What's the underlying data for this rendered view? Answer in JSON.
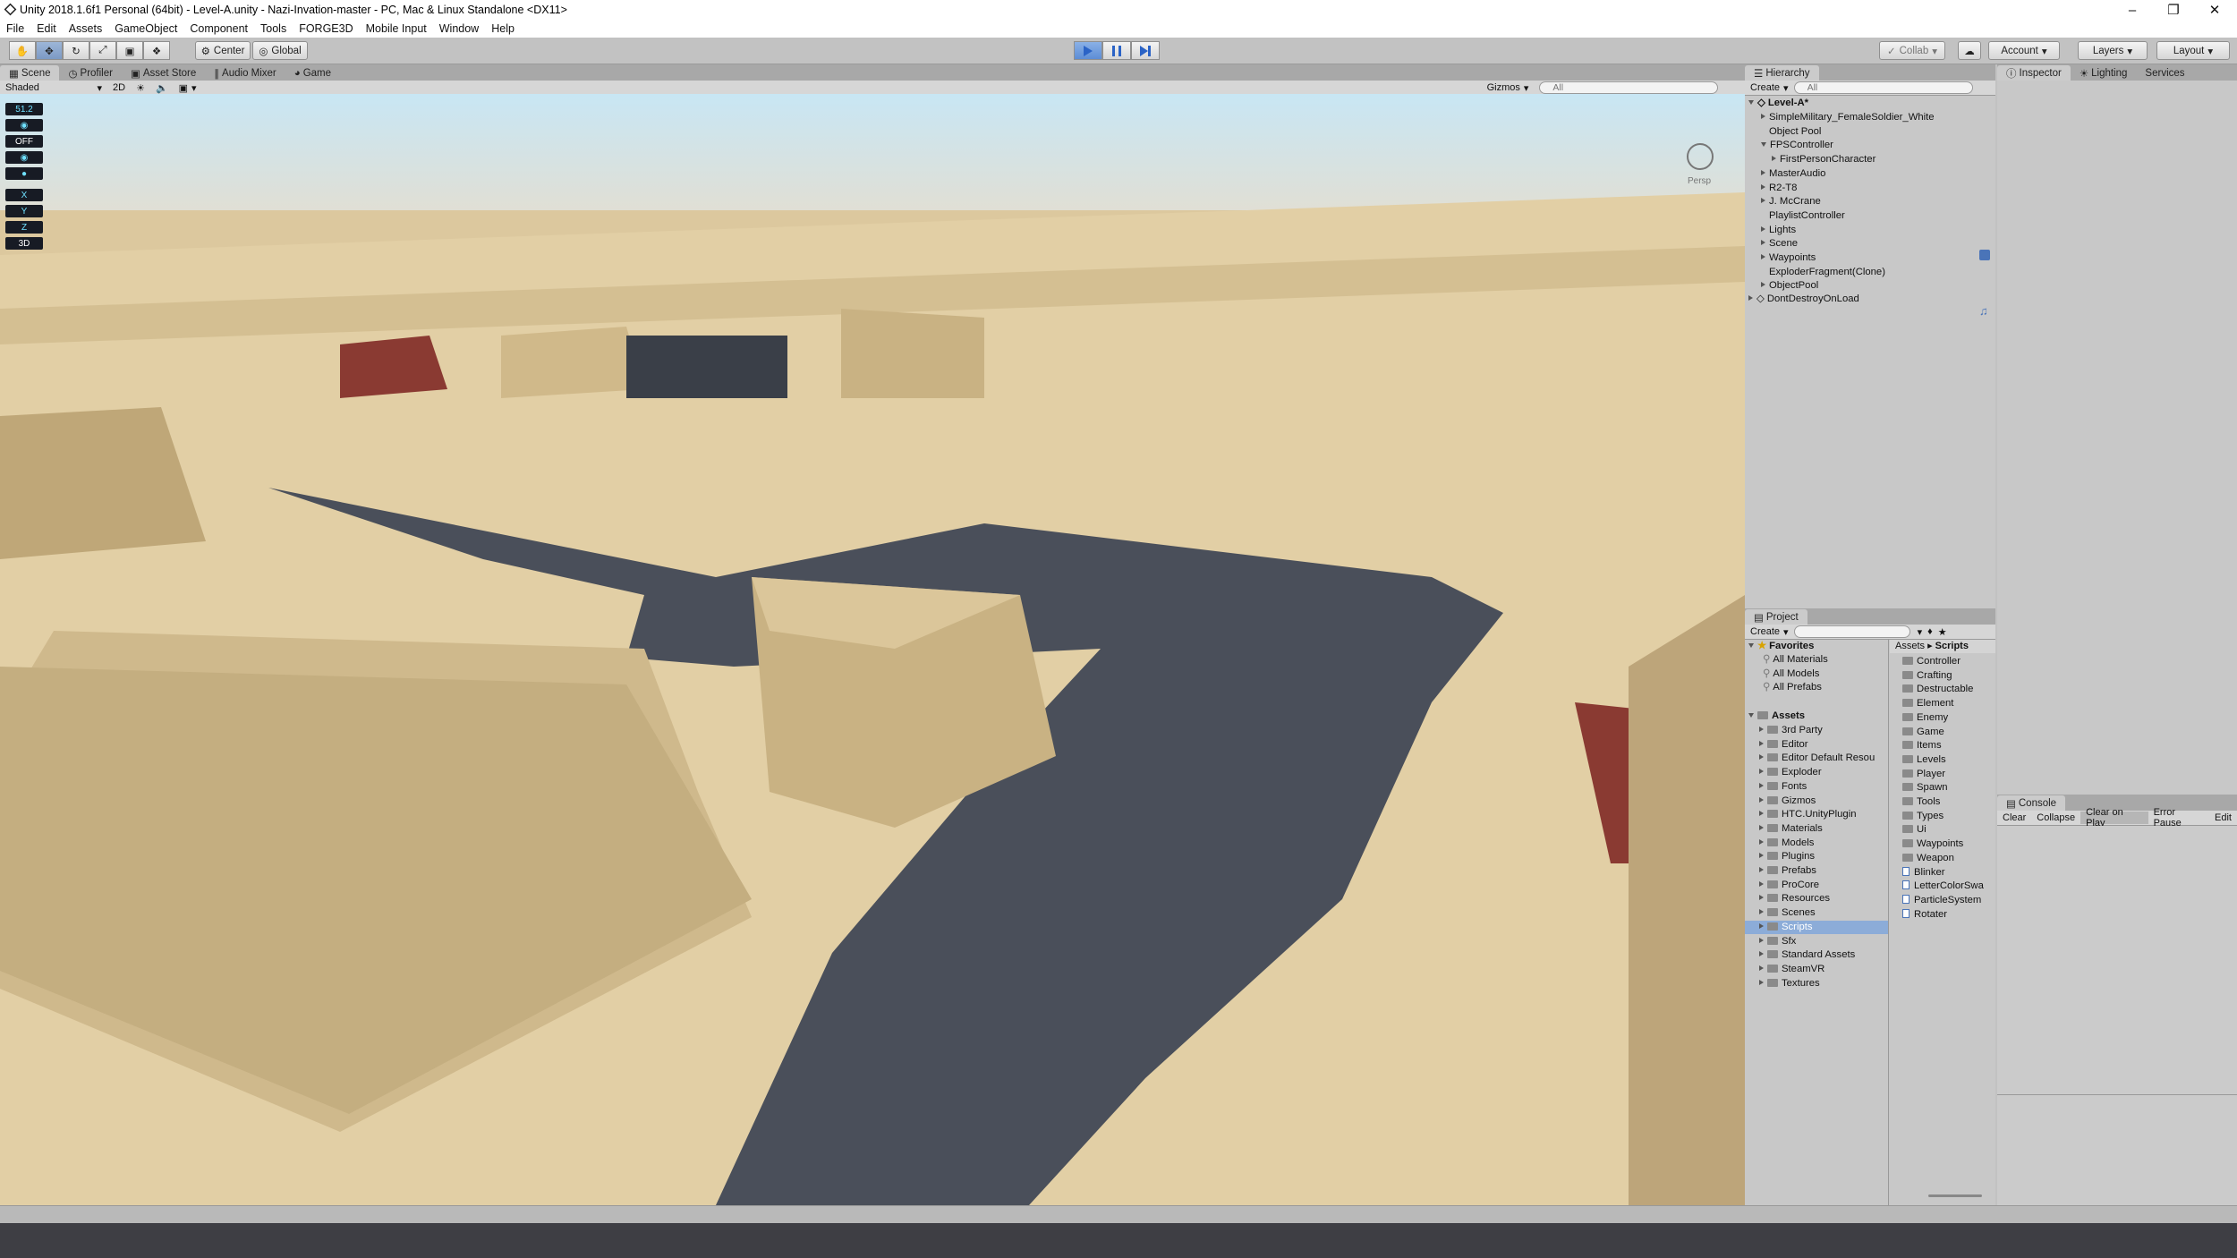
{
  "window": {
    "title": "Unity 2018.1.6f1 Personal (64bit) - Level-A.unity - Nazi-Invation-master - PC, Mac & Linux Standalone <DX11>"
  },
  "menu": [
    "File",
    "Edit",
    "Assets",
    "GameObject",
    "Component",
    "Tools",
    "FORGE3D",
    "Mobile Input",
    "Window",
    "Help"
  ],
  "toolbar": {
    "pivot": "Center",
    "space": "Global",
    "collab": "Collab",
    "account": "Account",
    "layers": "Layers",
    "layout": "Layout"
  },
  "scene_tabs": [
    "Scene",
    "Profiler",
    "Asset Store",
    "Audio Mixer",
    "Game"
  ],
  "scene_bar": {
    "shading": "Shaded",
    "mode_2d": "2D",
    "gizmos": "Gizmos",
    "search_placeholder": "All",
    "persp": "Persp"
  },
  "overlay": [
    "51.2",
    "OFF",
    "3D"
  ],
  "hierarchy": {
    "tab": "Hierarchy",
    "create": "Create",
    "search_placeholder": "All",
    "scene_name": "Level-A*",
    "items": [
      {
        "label": "SimpleMilitary_FemaleSoldier_White",
        "indent": 1,
        "arrow": "closed"
      },
      {
        "label": "Object Pool",
        "indent": 1,
        "arrow": "none"
      },
      {
        "label": "FPSController",
        "indent": 1,
        "arrow": "open"
      },
      {
        "label": "FirstPersonCharacter",
        "indent": 2,
        "arrow": "closed"
      },
      {
        "label": "MasterAudio",
        "indent": 1,
        "arrow": "closed"
      },
      {
        "label": "R2-T8",
        "indent": 1,
        "arrow": "closed"
      },
      {
        "label": "J. McCrane",
        "indent": 1,
        "arrow": "closed"
      },
      {
        "label": "PlaylistController",
        "indent": 1,
        "arrow": "none"
      },
      {
        "label": "Lights",
        "indent": 1,
        "arrow": "closed"
      },
      {
        "label": "Scene",
        "indent": 1,
        "arrow": "closed"
      },
      {
        "label": "Waypoints",
        "indent": 1,
        "arrow": "closed"
      },
      {
        "label": "ExploderFragment(Clone)",
        "indent": 1,
        "arrow": "none"
      },
      {
        "label": "ObjectPool",
        "indent": 1,
        "arrow": "closed"
      }
    ],
    "dont_destroy": "DontDestroyOnLoad"
  },
  "inspector_tabs": [
    "Inspector",
    "Lighting",
    "Services"
  ],
  "project": {
    "tab": "Project",
    "create": "Create",
    "favorites": "Favorites",
    "favorite_items": [
      "All Materials",
      "All Models",
      "All Prefabs"
    ],
    "assets": "Assets",
    "asset_folders": [
      "3rd Party",
      "Editor",
      "Editor Default Resou",
      "Exploder",
      "Fonts",
      "Gizmos",
      "HTC.UnityPlugin",
      "Materials",
      "Models",
      "Plugins",
      "Prefabs",
      "ProCore",
      "Resources",
      "Scenes",
      "Scripts",
      "Sfx",
      "Standard Assets",
      "SteamVR",
      "Textures"
    ],
    "selected_folder": "Scripts",
    "breadcrumb_root": "Assets",
    "breadcrumb_current": "Scripts",
    "right_folders": [
      "Controller",
      "Crafting",
      "Destructable",
      "Element",
      "Enemy",
      "Game",
      "Items",
      "Levels",
      "Player",
      "Spawn",
      "Tools",
      "Types",
      "Ui",
      "Waypoints",
      "Weapon"
    ],
    "right_scripts": [
      "Blinker",
      "LetterColorSwa",
      "ParticleSystem",
      "Rotater"
    ]
  },
  "console": {
    "tab": "Console",
    "buttons": [
      "Clear",
      "Collapse",
      "Clear on Play",
      "Error Pause",
      "Edit"
    ]
  },
  "colors": {
    "play_active": "#5d8dd6",
    "sand": "#dcc89e",
    "road": "#4a4f5a",
    "selection": "#8cacd8"
  }
}
